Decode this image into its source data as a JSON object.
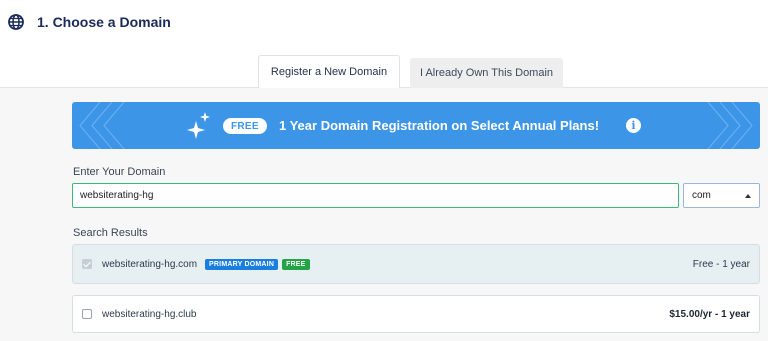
{
  "section": {
    "title": "1. Choose a Domain",
    "icon": "globe-icon"
  },
  "tabs": [
    {
      "label": "Register a New Domain",
      "active": true
    },
    {
      "label": "I Already Own This Domain",
      "active": false
    }
  ],
  "banner": {
    "pill": "FREE",
    "text": "1 Year Domain Registration on Select Annual Plans!",
    "icons": [
      "sparkle-icon",
      "info-icon"
    ],
    "color": "#3d95e8"
  },
  "domain_form": {
    "label": "Enter Your Domain",
    "value": "websiterating-hg",
    "tld": "com"
  },
  "results": {
    "label": "Search Results",
    "items": [
      {
        "domain": "websiterating-hg.com",
        "badges": [
          "PRIMARY DOMAIN",
          "FREE"
        ],
        "price": "Free - 1 year",
        "checked": true
      },
      {
        "domain": "websiterating-hg.club",
        "badges": [],
        "price": "$15.00/yr - 1 year",
        "checked": false
      }
    ]
  },
  "colors": {
    "accent": "#3d95e8",
    "primary_badge": "#1a7de0",
    "free_badge": "#22a447",
    "input_border": "#3cb878"
  }
}
